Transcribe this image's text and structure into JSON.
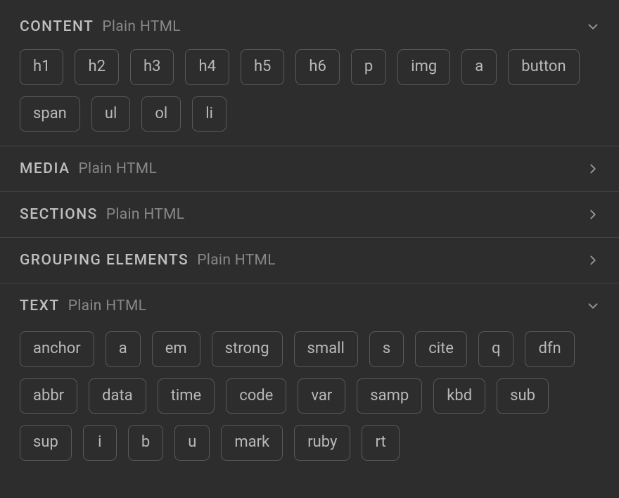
{
  "sections": [
    {
      "id": "content",
      "title": "CONTENT",
      "subtitle": "Plain HTML",
      "expanded": true,
      "items": [
        "h1",
        "h2",
        "h3",
        "h4",
        "h5",
        "h6",
        "p",
        "img",
        "a",
        "button",
        "span",
        "ul",
        "ol",
        "li"
      ]
    },
    {
      "id": "media",
      "title": "MEDIA",
      "subtitle": "Plain HTML",
      "expanded": false,
      "items": []
    },
    {
      "id": "sections",
      "title": "SECTIONS",
      "subtitle": "Plain HTML",
      "expanded": false,
      "items": []
    },
    {
      "id": "grouping",
      "title": "GROUPING ELEMENTS",
      "subtitle": "Plain HTML",
      "expanded": false,
      "items": []
    },
    {
      "id": "text",
      "title": "TEXT",
      "subtitle": "Plain HTML",
      "expanded": true,
      "items": [
        "anchor",
        "a",
        "em",
        "strong",
        "small",
        "s",
        "cite",
        "q",
        "dfn",
        "abbr",
        "data",
        "time",
        "code",
        "var",
        "samp",
        "kbd",
        "sub",
        "sup",
        "i",
        "b",
        "u",
        "mark",
        "ruby",
        "rt"
      ]
    }
  ]
}
